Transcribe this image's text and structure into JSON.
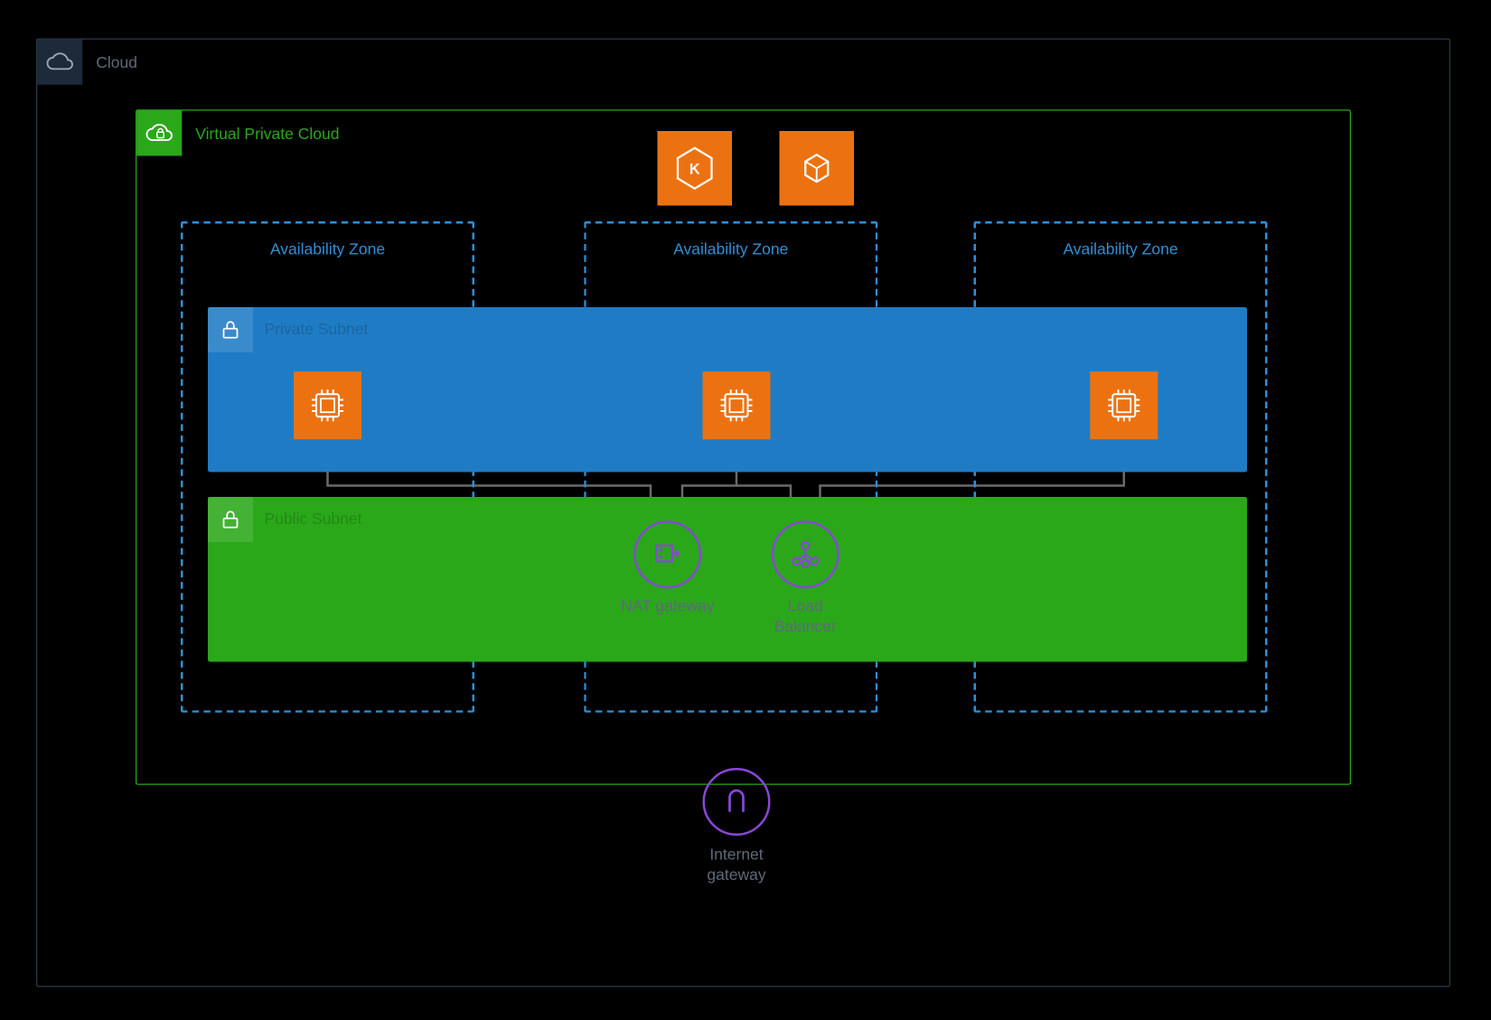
{
  "cloud": {
    "label": "Cloud"
  },
  "vpc": {
    "label": "Virtual Private Cloud"
  },
  "az": {
    "label1": "Availability Zone",
    "label2": "Availability Zone",
    "label3": "Availability Zone"
  },
  "subnets": {
    "private_label": "Private Subnet",
    "public_label": "Public Subnet"
  },
  "services": {
    "eks_name": "eks-service-icon",
    "container_name": "container-service-icon"
  },
  "compute": {
    "name": "compute-instance"
  },
  "nat": {
    "label": "NAT gateway"
  },
  "lb": {
    "label": "Load\nBalancer"
  },
  "igw": {
    "label": "Internet\ngateway"
  },
  "colors": {
    "orange": "#ec7211",
    "blue": "#2f8fd6",
    "green": "#2aa81a",
    "purple": "#8847d6",
    "transparent": "#1c2a3a"
  }
}
